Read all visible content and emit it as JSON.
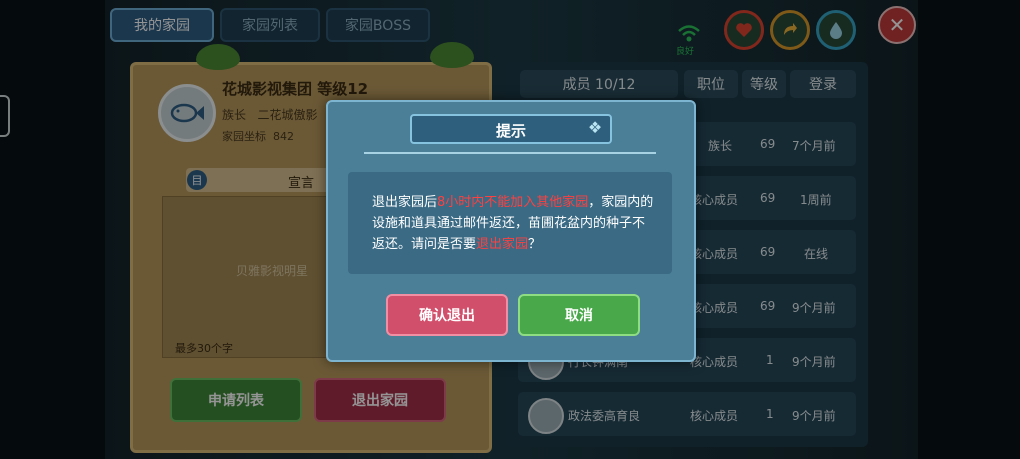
{
  "tabs": [
    "我的家园",
    "家园列表",
    "家园BOSS"
  ],
  "family": {
    "name_level": "花城影视集团 等级12",
    "leader_label": "族长",
    "leader_name": "二花城傲影",
    "coords_label": "家园坐标",
    "coords_value": "842"
  },
  "declaration": {
    "title": "宣言",
    "icon_glyph": "目",
    "text": "贝雅影视明星",
    "limit_note": "最多30个字"
  },
  "left_buttons": {
    "apply_list": "申请列表",
    "exit_home": "退出家园"
  },
  "members_header": {
    "members": "成员 10/12",
    "position": "职位",
    "level": "等级",
    "login": "登录"
  },
  "members": [
    {
      "name": "",
      "position": "族长",
      "level": "69",
      "login": "7个月前"
    },
    {
      "name": "",
      "position": "核心成员",
      "level": "69",
      "login": "1周前"
    },
    {
      "name": "",
      "position": "核心成员",
      "level": "69",
      "login": "在线"
    },
    {
      "name": "",
      "position": "核心成员",
      "level": "69",
      "login": "9个月前"
    },
    {
      "name": "行长钟满南",
      "position": "核心成员",
      "level": "1",
      "login": "9个月前"
    },
    {
      "name": "政法委高育良",
      "position": "核心成员",
      "level": "1",
      "login": "9个月前"
    }
  ],
  "hud": {
    "signal_label": "良好",
    "close_glyph": "✕",
    "icons": [
      "heart-icon",
      "arrow-icon",
      "drop-icon"
    ]
  },
  "modal": {
    "title": "提示",
    "text_1": "退出家园后",
    "text_red_1": "8小时内不能加入其他家园",
    "text_2": "，家园内的设施和道具通过邮件返还，苗圃花盆内的种子不返还。请问是否要",
    "text_red_2": "退出家园",
    "text_3": "？",
    "confirm_label": "确认退出",
    "cancel_label": "取消"
  },
  "colors": {
    "confirm": "#d24f6b",
    "cancel": "#49a84a",
    "danger_text": "#ff4040"
  }
}
